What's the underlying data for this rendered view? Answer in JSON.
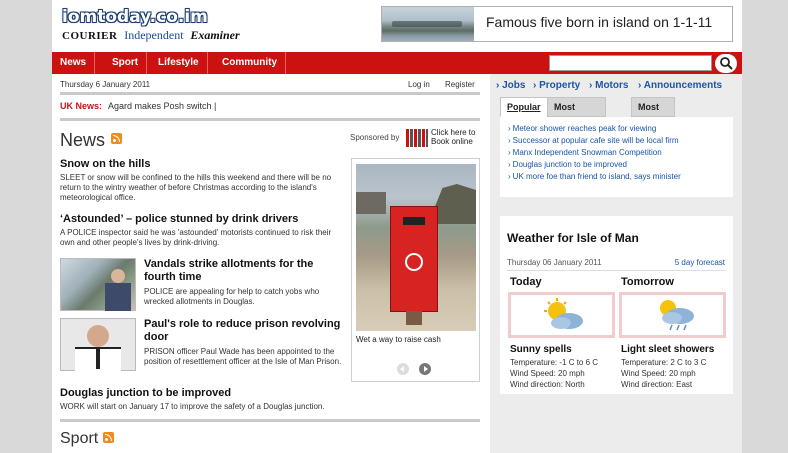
{
  "header": {
    "logo_text": "iomtoday.co.im",
    "publications": [
      "COURIER",
      "Independent",
      "Examiner"
    ],
    "ad_text": "Famous five born in island on 1-1-11"
  },
  "nav": {
    "items": [
      "News",
      "Sport",
      "Lifestyle",
      "Community"
    ],
    "search_placeholder": ""
  },
  "topbar": {
    "date": "Thursday 6 January 2011",
    "login": "Log in",
    "register": "Register"
  },
  "ticker": {
    "label": "UK News:",
    "text": "Agard makes Posh switch |"
  },
  "news": {
    "title": "News",
    "sponsor_label": "Sponsored by",
    "sponsor_text": "Click here to Book online",
    "stories": [
      {
        "headline": "Snow on the hills",
        "summary": "SLEET or snow will be confined to the hills this weekend and there will be no return to the wintry weather of before Christmas according to the island's meteorological office."
      },
      {
        "headline": "‘Astounded’ – police stunned by drink drivers",
        "summary": "A POLICE inspector said he was 'astounded' motorists continued to risk their own and other people's lives by drink-driving."
      },
      {
        "headline": "Vandals strike allotments for the fourth time",
        "summary": "POLICE are appealing for help to catch yobs who wrecked allotments in Douglas."
      },
      {
        "headline": "Paul's role to reduce prison revolving door",
        "summary": "PRISON officer Paul Wade has been appointed to the position of resettlement officer at the Isle of Man Prison."
      },
      {
        "headline": "Douglas junction to be improved",
        "summary": "WORK will start on January 17 to improve the safety of a Douglas junction."
      }
    ],
    "feature_caption": "Wet a way to raise cash"
  },
  "sport": {
    "title": "Sport"
  },
  "right": {
    "top_links": [
      "Jobs",
      "Property",
      "Motors",
      "Announcements"
    ],
    "tabs": [
      "Popular",
      "Most comments",
      "Most shared"
    ],
    "popular": [
      "Meteor shower reaches peak for viewing",
      "Successor at popular cafe site will be local firm",
      "Manx Independent Snowman Competition",
      "Douglas junction to be improved",
      "UK more foe than friend to island, says minister"
    ]
  },
  "weather": {
    "title": "Weather for Isle of Man",
    "date": "Thursday 06 January 2011",
    "forecast_link": "5 day forecast",
    "days": [
      {
        "label": "Today",
        "condition": "Sunny spells",
        "temperature": "Temperature: -1 C to 6 C",
        "wind_speed": "Wind Speed: 20 mph",
        "wind_direction": "Wind direction: North"
      },
      {
        "label": "Tomorrow",
        "condition": "Light sleet showers",
        "temperature": "Temperature: 2 C to 3 C",
        "wind_speed": "Wind Speed: 20 mph",
        "wind_direction": "Wind direction: East"
      }
    ]
  },
  "colors": {
    "brand_red": "#cc1111",
    "link_blue": "#1a55a8",
    "rss_orange": "#f28b1c"
  }
}
